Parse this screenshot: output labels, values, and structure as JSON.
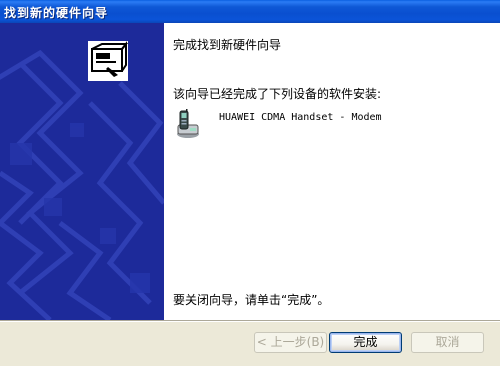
{
  "window": {
    "title": "找到新的硬件向导"
  },
  "wizard": {
    "heading": "完成找到新硬件向导",
    "description": "该向导已经完成了下列设备的软件安装:",
    "device_name": "HUAWEI CDMA Handset - Modem",
    "finish_hint": "要关闭向导，请单击“完成”。"
  },
  "buttons": {
    "back": "< 上一步(B)",
    "finish": "完成",
    "cancel": "取消"
  },
  "colors": {
    "titlebar": "#0a54d8",
    "sidebar": "#1d2a9a",
    "dialog_face": "#ece9d8"
  },
  "icons": {
    "wizard": "hardware-wizard-icon",
    "device": "modem-phone-icon"
  }
}
